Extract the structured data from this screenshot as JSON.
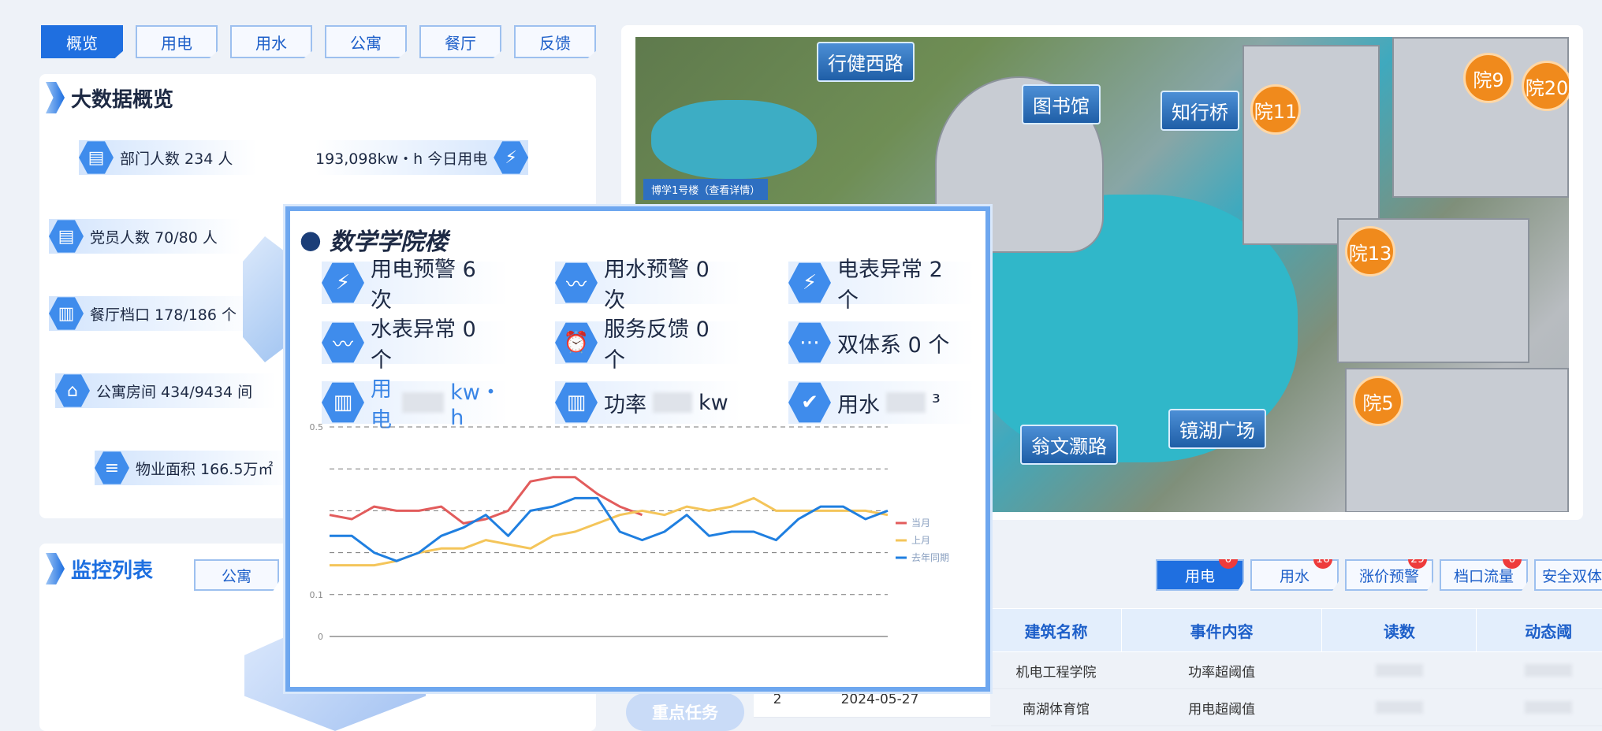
{
  "tabs": [
    "概览",
    "用电",
    "用水",
    "公寓",
    "餐厅",
    "反馈"
  ],
  "overview": {
    "title": "大数据概览",
    "dept": "部门人数 234 人",
    "power_today": "193,098kw・h 今日用电",
    "party": "党员人数 70/80 人",
    "canteen": "餐厅档口 178/186 个",
    "apartment": "公寓房间 434/9434 间",
    "area": "物业面积 166.5万㎡"
  },
  "monitor": {
    "title": "监控列表",
    "tab": "公寓"
  },
  "map": {
    "labels": [
      "行健西路",
      "图书馆",
      "知行桥",
      "翁文灏路",
      "镜湖广场"
    ],
    "pins": [
      "院11",
      "院9",
      "院20",
      "院13",
      "院5"
    ],
    "tooltip": "博学1号楼（查看详情）"
  },
  "popup": {
    "title": "数学学院楼",
    "cards": [
      {
        "icon": "lightning-icon",
        "text": "用电预警 6 次"
      },
      {
        "icon": "water-trend-icon",
        "text": "用水预警 0 次"
      },
      {
        "icon": "lightning-icon",
        "text": "电表异常 2 个"
      },
      {
        "icon": "water-trend-icon",
        "text": "水表异常 0 个"
      },
      {
        "icon": "alarm-icon",
        "text": "服务反馈 0 个"
      },
      {
        "icon": "more-icon",
        "text": "双体系 0 个"
      }
    ],
    "usage": [
      {
        "label": "用电",
        "unit": "kw・h"
      },
      {
        "label": "功率",
        "unit": "kw"
      },
      {
        "label": "用水",
        "unit": "³"
      }
    ]
  },
  "chart_data": {
    "type": "line",
    "ylim": [
      0,
      0.5
    ],
    "yticks": [
      0,
      0.1,
      0.5
    ],
    "series": [
      {
        "name": "当月",
        "color": "#e25c5c",
        "values": [
          0.29,
          0.28,
          0.31,
          0.3,
          0.3,
          0.31,
          0.27,
          0.28,
          0.3,
          0.37,
          0.38,
          0.38,
          0.34,
          0.31,
          0.29
        ]
      },
      {
        "name": "上月",
        "color": "#f4c55a",
        "values": [
          0.17,
          0.17,
          0.17,
          0.18,
          0.2,
          0.21,
          0.21,
          0.23,
          0.22,
          0.21,
          0.24,
          0.25,
          0.27,
          0.29,
          0.3,
          0.29,
          0.31,
          0.3,
          0.31,
          0.33,
          0.3,
          0.3,
          0.3,
          0.3,
          0.3,
          0.29
        ]
      },
      {
        "name": "去年同期",
        "color": "#1f7fe0",
        "values": [
          0.24,
          0.24,
          0.2,
          0.18,
          0.2,
          0.24,
          0.26,
          0.29,
          0.24,
          0.3,
          0.31,
          0.33,
          0.33,
          0.25,
          0.23,
          0.25,
          0.29,
          0.24,
          0.25,
          0.25,
          0.23,
          0.28,
          0.31,
          0.31,
          0.28,
          0.3
        ]
      }
    ]
  },
  "alerts": {
    "tabs": [
      {
        "label": "用电",
        "badge": "0",
        "active": true
      },
      {
        "label": "用水",
        "badge": "16"
      },
      {
        "label": "涨价预警",
        "badge": "29"
      },
      {
        "label": "档口流量",
        "badge": "0"
      },
      {
        "label": "安全双体",
        "badge": ""
      }
    ],
    "headers": [
      "建筑名称",
      "事件内容",
      "读数",
      "动态阈"
    ],
    "rows": [
      {
        "no": "",
        "date": "",
        "building": "机电工程学院",
        "event": "功率超阈值"
      },
      {
        "no": "2",
        "date": "2024-05-27",
        "building": "南湖体育馆",
        "event": "用电超阈值"
      }
    ],
    "side_button": "重点任务"
  }
}
